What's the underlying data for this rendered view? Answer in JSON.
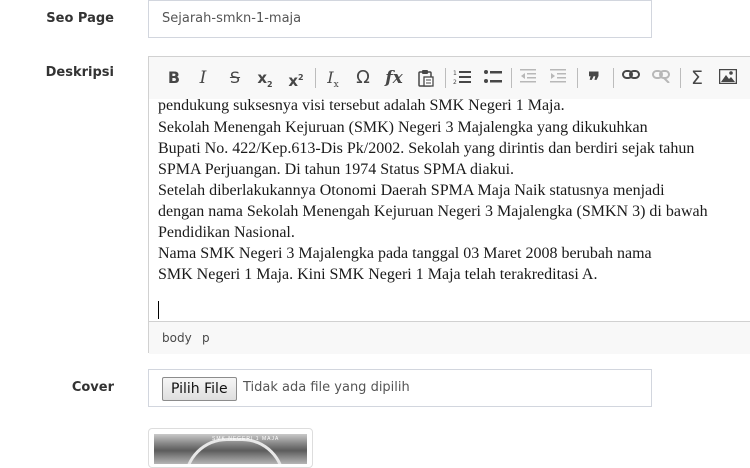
{
  "form": {
    "seo": {
      "label": "Seo Page",
      "value": "Sejarah-smkn-1-maja"
    },
    "deskripsi": {
      "label": "Deskripsi",
      "toolbar": [
        {
          "name": "bold-button",
          "icon": "bold-icon",
          "glyph": "B"
        },
        {
          "name": "italic-button",
          "icon": "italic-icon",
          "glyph": "I"
        },
        {
          "name": "strike-button",
          "icon": "strikethrough-icon",
          "glyph": "S"
        },
        {
          "name": "subscript-button",
          "icon": "subscript-icon",
          "glyph": "x₂"
        },
        {
          "name": "superscript-button",
          "icon": "superscript-icon",
          "glyph": "x²"
        },
        {
          "name": "remove-format-button",
          "icon": "remove-format-icon",
          "glyph": "Ix"
        },
        {
          "name": "special-char-button",
          "icon": "omega-icon",
          "glyph": "Ω"
        },
        {
          "name": "formula-button",
          "icon": "function-icon",
          "glyph": "fx"
        },
        {
          "name": "paste-button",
          "icon": "paste-icon",
          "glyph": "paste"
        },
        {
          "name": "numbered-list-button",
          "icon": "numbered-list-icon",
          "glyph": "ol"
        },
        {
          "name": "bulleted-list-button",
          "icon": "bulleted-list-icon",
          "glyph": "ul"
        },
        {
          "name": "outdent-button",
          "icon": "outdent-icon",
          "glyph": "outdent",
          "disabled": true
        },
        {
          "name": "indent-button",
          "icon": "indent-icon",
          "glyph": "indent",
          "disabled": true
        },
        {
          "name": "blockquote-button",
          "icon": "quote-icon",
          "glyph": "❞"
        },
        {
          "name": "link-button",
          "icon": "link-icon",
          "glyph": "link"
        },
        {
          "name": "unlink-button",
          "icon": "unlink-icon",
          "glyph": "unlink",
          "disabled": true
        },
        {
          "name": "sum-button",
          "icon": "sigma-icon",
          "glyph": "Σ"
        },
        {
          "name": "image-button",
          "icon": "image-icon",
          "glyph": "img"
        }
      ],
      "content": [
        "pendukung suksesnya visi tersebut adalah SMK Negeri 1 Maja.",
        "            Sekolah   Menengah   Kejuruan  (SMK)   Negeri  3   Majalengka yang dikukuhkan",
        "Bupati No. 422/Kep.613-Dis Pk/2002. Sekolah yang dirintis dan berdiri sejak tahun",
        "SPMA Perjuangan. Di tahun 1974 Status SPMA diakui.",
        "            Setelah diberlakukannya Otonomi Daerah SPMA Maja Naik statusnya  menjadi",
        "dengan   nama  Sekolah Menengah Kejuruan Negeri 3 Majalengka (SMKN 3) di bawah",
        "Pendidikan Nasional.",
        "             Nama SMK Negeri 3 Majalengka pada tanggal 03 Maret 2008 berubah nama",
        "SMK Negeri 1 Maja. Kini SMK Negeri 1 Maja telah terakreditasi A."
      ],
      "path": [
        "body",
        "p"
      ]
    },
    "cover": {
      "label": "Cover",
      "button": "Pilih File",
      "status": "Tidak ada file yang dipilih",
      "thumb_text": "SMK NEGERI 1 MAJA"
    }
  }
}
